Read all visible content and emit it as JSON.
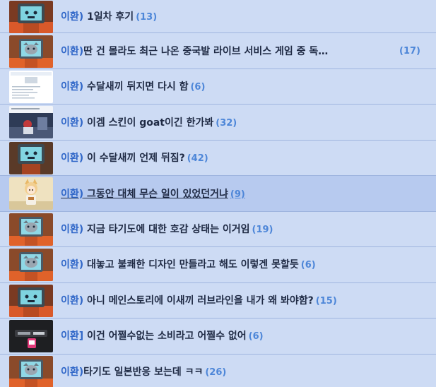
{
  "posts": [
    {
      "prefix": "이환)",
      "title": " 1일차 후기",
      "count": "(13)",
      "thumb": "mascot-bluescreen-icon"
    },
    {
      "prefix": "이환)",
      "title": "딴 건 몰라도 최근 나온 중국발 라이브 서비스 게임 중 독…",
      "count": "(17)",
      "thumb": "mascot-cat-icon"
    },
    {
      "prefix": "이환)",
      "title": " 수달새끼 뒤지면 다시 함",
      "count": "(6)",
      "thumb": "document-screenshot-icon"
    },
    {
      "prefix": "이환)",
      "title": " 이겜 스킨이 goat이긴 한가봐",
      "count": "(32)",
      "thumb": "game-screenshot-icon"
    },
    {
      "prefix": "이환)",
      "title": " 이 수달새끼 언제 뒤짐?",
      "count": "(42)",
      "thumb": "mascot-bluescreen-icon"
    },
    {
      "prefix": "이환)",
      "title": " 그동안 대체 무슨 일이 있었던거냐",
      "count": "(9)",
      "thumb": "fox-girl-icon"
    },
    {
      "prefix": "이환)",
      "title": " 지금 타기도에 대한 호감 상태는 이거임",
      "count": "(19)",
      "thumb": "mascot-cat-icon"
    },
    {
      "prefix": "이환)",
      "title": " 대놓고 불쾌한 디자인 만들라고 해도 이렇겐 못할듯",
      "count": "(6)",
      "thumb": "mascot-cat-icon"
    },
    {
      "prefix": "이환)",
      "title": " 아니 메인스토리에 이새끼 러브라인을 내가 왜 봐야함?",
      "count": "(15)",
      "thumb": "mascot-bluescreen-icon"
    },
    {
      "prefix": "이환]",
      "title": " 이건 어쩔수없는 소비라고 어쩔수 없어",
      "count": "(6)",
      "thumb": "phone-screenshot-icon"
    },
    {
      "prefix": "이환)",
      "title": "타기도 일본반응 보는데 ㅋㅋ",
      "count": "(26)",
      "thumb": "mascot-cat-icon"
    }
  ],
  "colors": {
    "row_bg": "#cddbf4",
    "row_active_bg": "#b7caef",
    "prefix": "#2f66c8",
    "count": "#4d86d8",
    "title": "#1f2a44"
  }
}
